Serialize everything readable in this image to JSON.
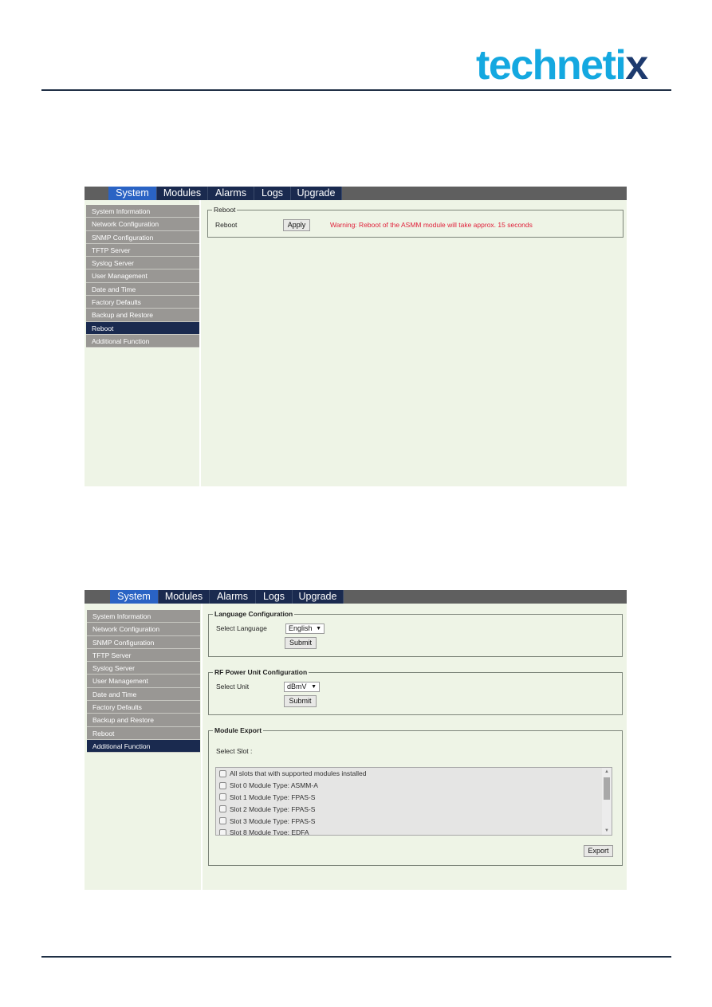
{
  "brand": {
    "logo_main": "techneti",
    "logo_x": "x"
  },
  "nav": {
    "tabs": [
      {
        "label": "System",
        "active": true
      },
      {
        "label": "Modules"
      },
      {
        "label": "Alarms"
      },
      {
        "label": "Logs"
      },
      {
        "label": "Upgrade"
      }
    ]
  },
  "sidebar": {
    "items": [
      "System Information",
      "Network Configuration",
      "SNMP Configuration",
      "TFTP Server",
      "Syslog Server",
      "User Management",
      "Date and Time",
      "Factory Defaults",
      "Backup and Restore",
      "Reboot",
      "Additional Function"
    ]
  },
  "screen1": {
    "active_sidebar": "Reboot",
    "reboot": {
      "legend": "Reboot",
      "label": "Reboot",
      "apply_label": "Apply",
      "warning": "Warning: Reboot of the ASMM module will take approx. 15 seconds"
    }
  },
  "screen2": {
    "active_sidebar": "Additional Function",
    "language": {
      "legend": "Language Configuration",
      "label": "Select Language",
      "selected": "English",
      "submit_label": "Submit"
    },
    "rf_unit": {
      "legend": "RF Power Unit Configuration",
      "label": "Select Unit",
      "selected": "dBmV",
      "submit_label": "Submit"
    },
    "module_export": {
      "legend": "Module Export",
      "label": "Select Slot :",
      "options": [
        "All slots that with supported modules installed",
        "Slot 0 Module Type: ASMM-A",
        "Slot 1 Module Type: FPAS-S",
        "Slot 2 Module Type: FPAS-S",
        "Slot 3 Module Type: FPAS-S",
        "Slot 8 Module Type: EDFA"
      ],
      "export_label": "Export"
    }
  },
  "colors": {
    "brand_blue": "#14a8e0",
    "brand_navy": "#1d3a6e",
    "nav_active": "#2a63c4",
    "nav_tab": "#1a2a4f",
    "warning": "#e0203a",
    "panel_bg": "#eef4e6"
  },
  "arrow_glyph": "▼"
}
